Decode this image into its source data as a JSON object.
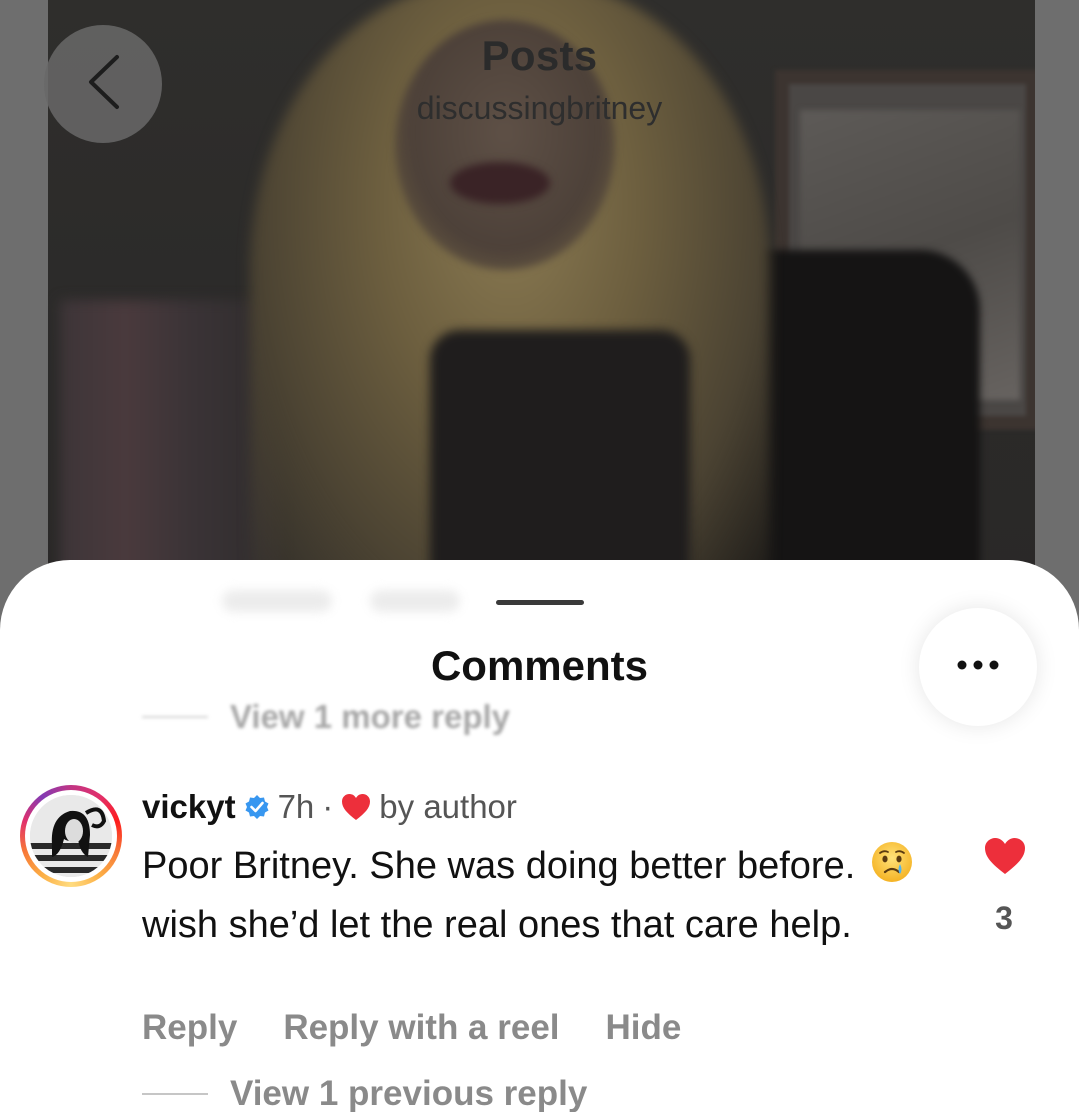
{
  "header": {
    "title": "Posts",
    "subtitle": "discussingbritney",
    "back_icon": "chevron-left-icon"
  },
  "comments_sheet": {
    "title": "Comments",
    "more_icon": "more-horizontal-icon",
    "view_more_reply": "View 1 more reply",
    "comment": {
      "username": "vickyt",
      "verified": true,
      "time": "7h",
      "separator": "·",
      "liked_by_author_label": "by author",
      "text_part1": "Poor Britney. She was doing better before.",
      "emoji_icon": "crying-face-emoji",
      "text_part2": "wish she’d let the real ones that care help.",
      "like_count": "3",
      "like_color": "#ed2f3b",
      "verified_color": "#3897f0"
    },
    "actions": {
      "reply": "Reply",
      "reply_with_reel": "Reply with a reel",
      "hide": "Hide"
    },
    "view_previous_reply": "View 1 previous reply"
  }
}
